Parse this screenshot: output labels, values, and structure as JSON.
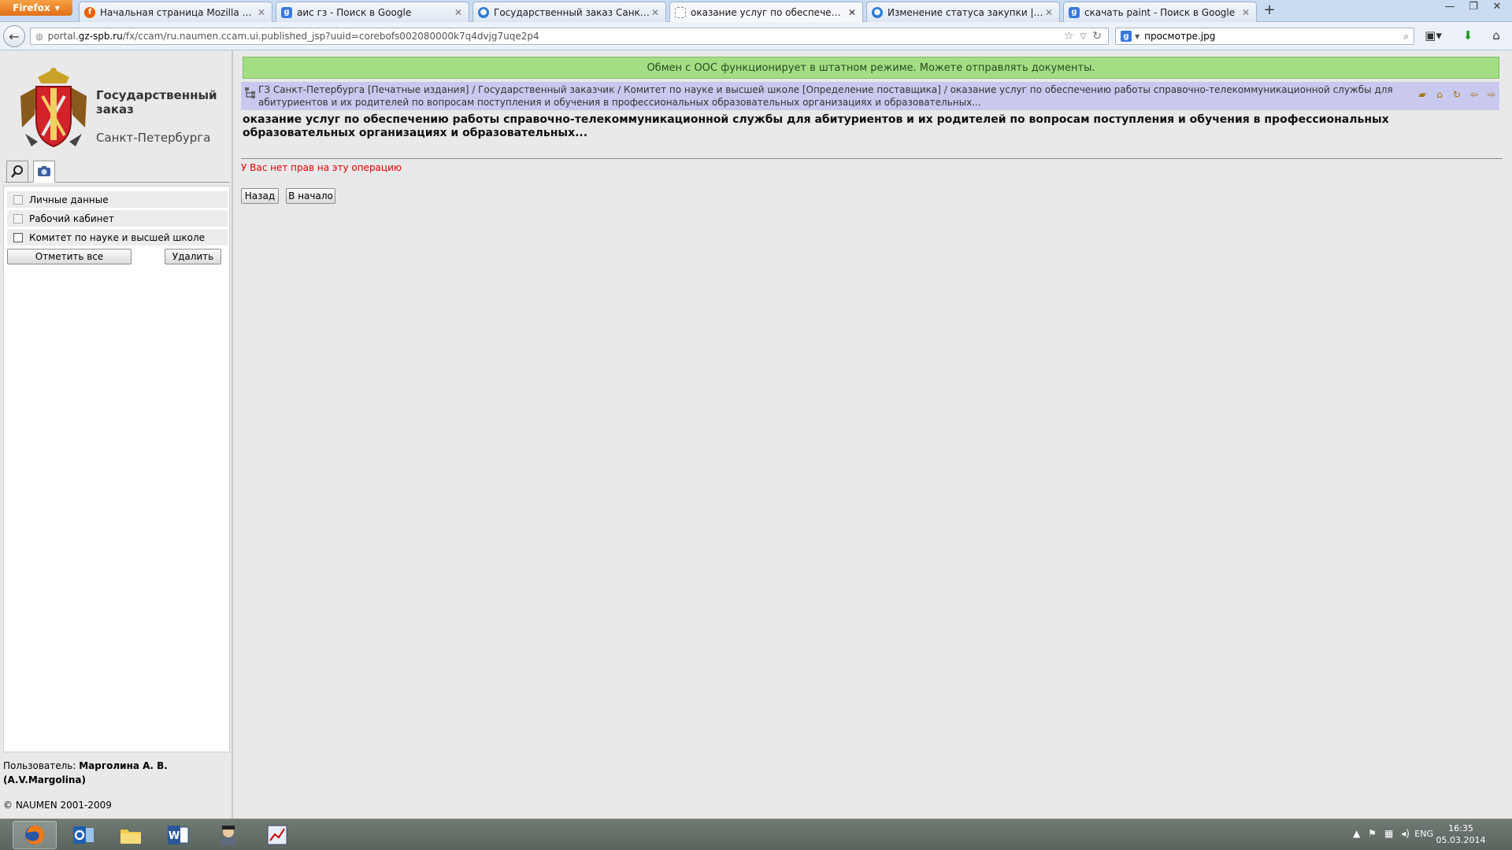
{
  "browser": {
    "menu_button": "Firefox",
    "tabs": [
      {
        "label": "Начальная страница Mozilla Firefox",
        "icon": "firefox-icon",
        "color": "#e66000"
      },
      {
        "label": "аис гз - Поиск в Google",
        "icon": "google-icon",
        "color": "#3a78e0"
      },
      {
        "label": "Государственный заказ Санкт-Пете...",
        "icon": "globe-icon",
        "color": "#2d7bd6"
      },
      {
        "label": "оказание услуг по обеспечению ра...",
        "icon": "page-icon",
        "color": "#ffffff"
      },
      {
        "label": "Изменение статуса закупки | HelpD...",
        "icon": "globe-icon",
        "color": "#2d7bd6"
      },
      {
        "label": "скачать paint - Поиск в Google",
        "icon": "google-icon",
        "color": "#3a78e0"
      }
    ],
    "new_tab": "+",
    "url_host": "portal.gz-spb.ru",
    "url_path": "/fx/ccam/ru.naumen.ccam.ui.published_jsp?uuid=corebofs002080000k7q4dvjg7uqe2p4",
    "url_prefix": "portal.",
    "url_host_bold": "gz-spb.ru",
    "search_value": "просмотре.jpg"
  },
  "sidebar": {
    "brand_title": "Государственный заказ",
    "brand_sub": "Санкт-Петербурга",
    "items": [
      {
        "label": "Личные данные"
      },
      {
        "label": "Рабочий кабинет"
      },
      {
        "label": "Комитет по науке и высшей школе"
      }
    ],
    "select_all_label": "Отметить все",
    "delete_label": "Удалить",
    "user_prefix": "Пользователь: ",
    "user_name": "Марголина А. В.",
    "user_login": "(A.V.Margolina)",
    "copyright": "© NAUMEN 2001-2009"
  },
  "main": {
    "status_banner": "Обмен с ООС функционирует в штатном режиме. Можете отправлять документы.",
    "breadcrumb": "ГЗ Санкт-Петербурга [Печатные издания] / Государственный заказчик / Комитет по науке и высшей школе [Определение поставщика] / оказание услуг по обеспечению работы справочно-телекоммуникационной службы для абитуриентов и их родителей по вопросам поступления и обучения в профессиональных образовательных организациях и образовательных...",
    "title": "оказание услуг по обеспечению работы справочно-телекоммуникационной службы для абитуриентов и их родителей по вопросам поступления и обучения в профессиональных образовательных организациях и образовательных...",
    "error": "У Вас нет прав на эту операцию",
    "back_label": "Назад",
    "home_label": "В начало"
  },
  "taskbar": {
    "lang": "ENG",
    "time": "16:35",
    "date": "05.03.2014"
  },
  "colors": {
    "banner_green": "#a3de85",
    "breadcrumb_lavender": "#c9c9ef",
    "error_red": "#e00000"
  }
}
